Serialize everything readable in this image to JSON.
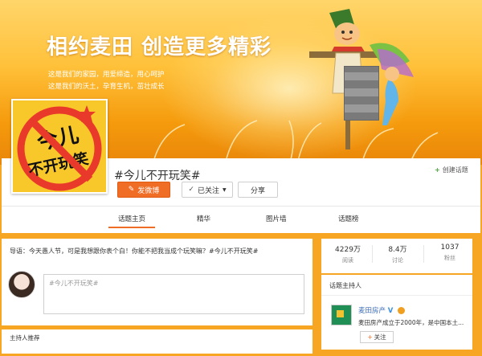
{
  "banner": {
    "title": "相约麦田  创造更多精彩",
    "subtitle_line1": "这是我们的家园，用爱缔造，用心呵护",
    "subtitle_line2": "这是我们的沃土，孕育生机，茁壮成长"
  },
  "avatar": {
    "text_line1": "今儿",
    "text_line2": "不开玩笑"
  },
  "topic": {
    "name": "#今儿不开玩笑#"
  },
  "actions": {
    "post_label": "发微博",
    "followed_label": "已关注",
    "share_label": "分享",
    "create_topic_label": "创建话题"
  },
  "tabs": [
    {
      "label": "话题主页",
      "active": true
    },
    {
      "label": "精华",
      "active": false
    },
    {
      "label": "图片墙",
      "active": false
    },
    {
      "label": "话题榜",
      "active": false
    }
  ],
  "guide": {
    "text": "导语：今天愚人节，可是我想跟你表个白！你能不把我当成个玩笑嘛？#今儿不开玩笑#"
  },
  "composer": {
    "text": "#今儿不开玩笑#"
  },
  "host_recommend": {
    "label": "主持人推荐"
  },
  "stats": [
    {
      "value": "4229万",
      "label": "阅读"
    },
    {
      "value": "8.4万",
      "label": "讨论"
    },
    {
      "value": "1037",
      "label": "粉丝"
    }
  ],
  "host": {
    "title": "话题主持人",
    "name": "麦田房产",
    "verified_mark": "V",
    "description": "麦田房产成立于2000年，是中国本土...",
    "follow_label": "关注"
  },
  "colors": {
    "accent": "#f06d26",
    "banner": "#f6a623",
    "link": "#3a6bb8"
  }
}
